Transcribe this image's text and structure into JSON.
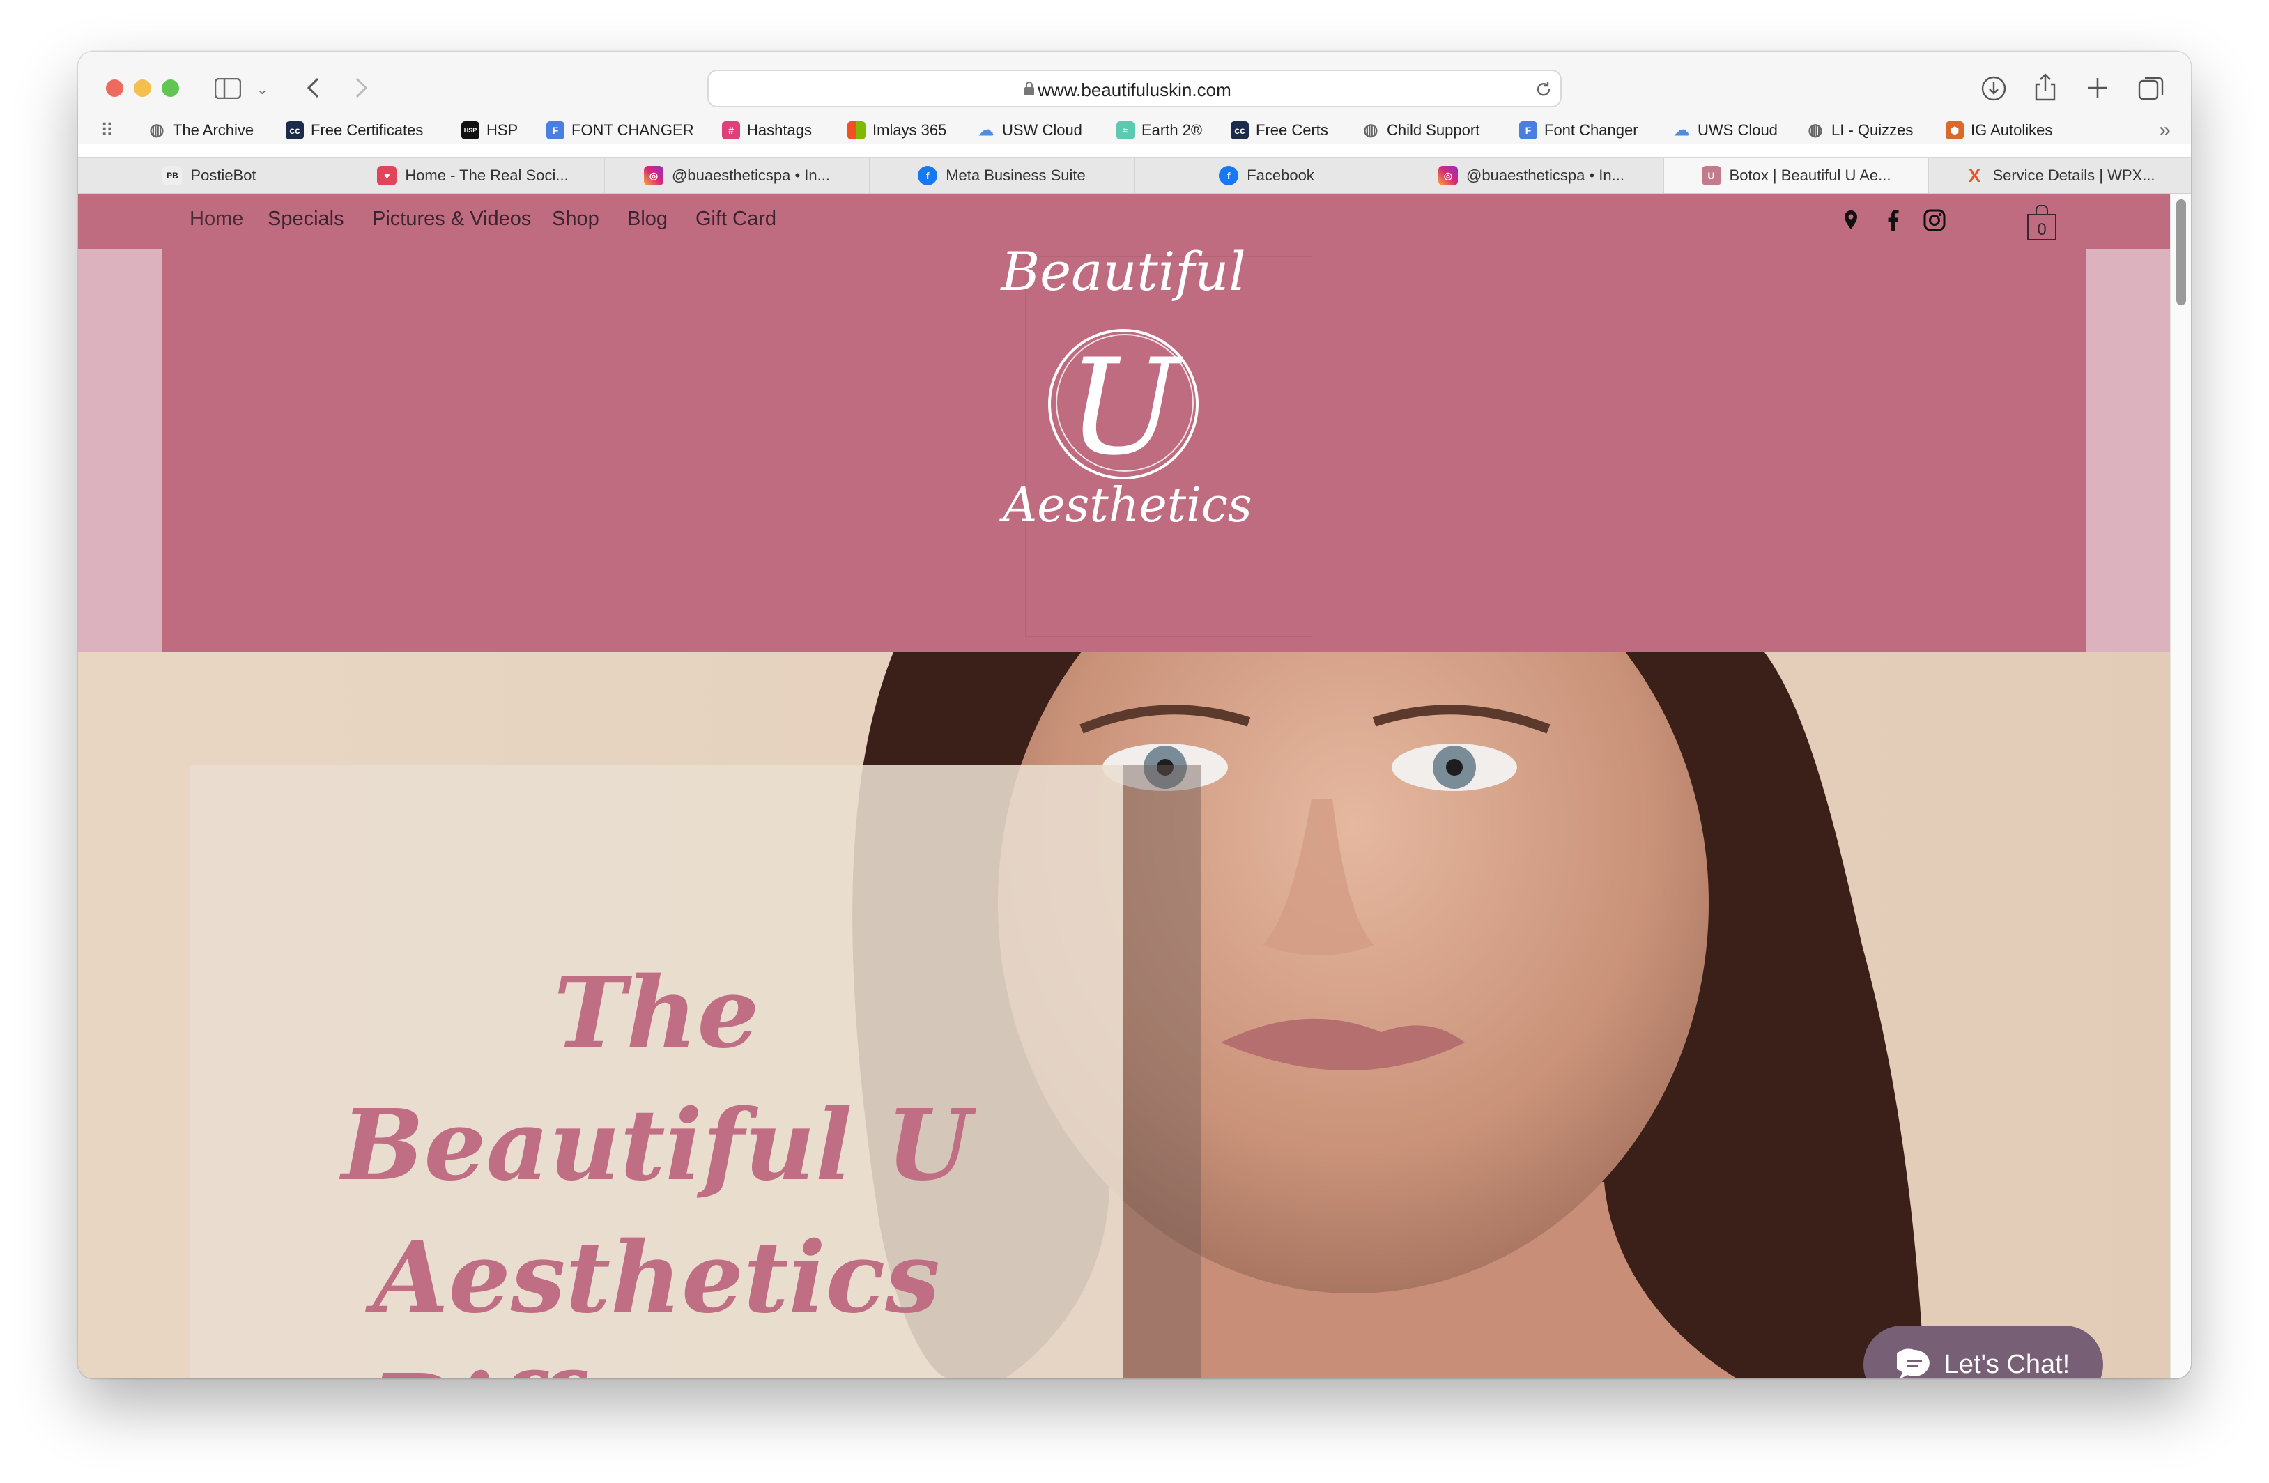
{
  "browser": {
    "url": "www.beautifuluskin.com",
    "bookmarks": [
      {
        "label": "The Archive",
        "icon": "globe-icon"
      },
      {
        "label": "Free Certificates",
        "icon": "cc-icon"
      },
      {
        "label": "HSP",
        "icon": "hsp-icon"
      },
      {
        "label": "FONT CHANGER",
        "icon": "font-changer-icon"
      },
      {
        "label": "Hashtags",
        "icon": "hashtags-icon"
      },
      {
        "label": "Imlays 365",
        "icon": "microsoft-icon"
      },
      {
        "label": "USW Cloud",
        "icon": "cloud-icon"
      },
      {
        "label": "Earth 2®",
        "icon": "earth2-icon"
      },
      {
        "label": "Free Certs",
        "icon": "cc-icon"
      },
      {
        "label": "Child Support",
        "icon": "globe-icon"
      },
      {
        "label": "Font Changer",
        "icon": "font-changer-icon"
      },
      {
        "label": "UWS Cloud",
        "icon": "cloud-icon"
      },
      {
        "label": "LI - Quizzes",
        "icon": "globe-icon"
      },
      {
        "label": "IG Autolikes",
        "icon": "hexagon-icon"
      }
    ],
    "tabs": [
      {
        "label": "PostieBot",
        "icon_text": "PB"
      },
      {
        "label": "Home - The Real Soci...",
        "icon_text": "♥"
      },
      {
        "label": "@buaestheticspa • In...",
        "icon_text": "◎"
      },
      {
        "label": "Meta Business Suite",
        "icon_text": "f"
      },
      {
        "label": "Facebook",
        "icon_text": "f"
      },
      {
        "label": "@buaestheticspa • In...",
        "icon_text": "◎"
      },
      {
        "label": "Botox | Beautiful U Ae...",
        "icon_text": "U"
      },
      {
        "label": "Service Details | WPX...",
        "icon_text": "X"
      }
    ]
  },
  "site": {
    "nav": [
      "Home",
      "Specials",
      "Pictures & Videos",
      "Shop",
      "Blog",
      "Gift Card"
    ],
    "cart_count": "0",
    "logo": {
      "top": "Beautiful",
      "letter": "U",
      "bottom": "Aesthetics"
    },
    "hero_lines": [
      "The",
      "Beautiful U",
      "Aesthetics",
      "Difference"
    ],
    "chat_label": "Let's Chat!"
  },
  "colors": {
    "header_pink": "#bf6b80",
    "side_pink": "#dcb2be",
    "hero_text": "#c06e84",
    "chat_button": "#776076"
  }
}
